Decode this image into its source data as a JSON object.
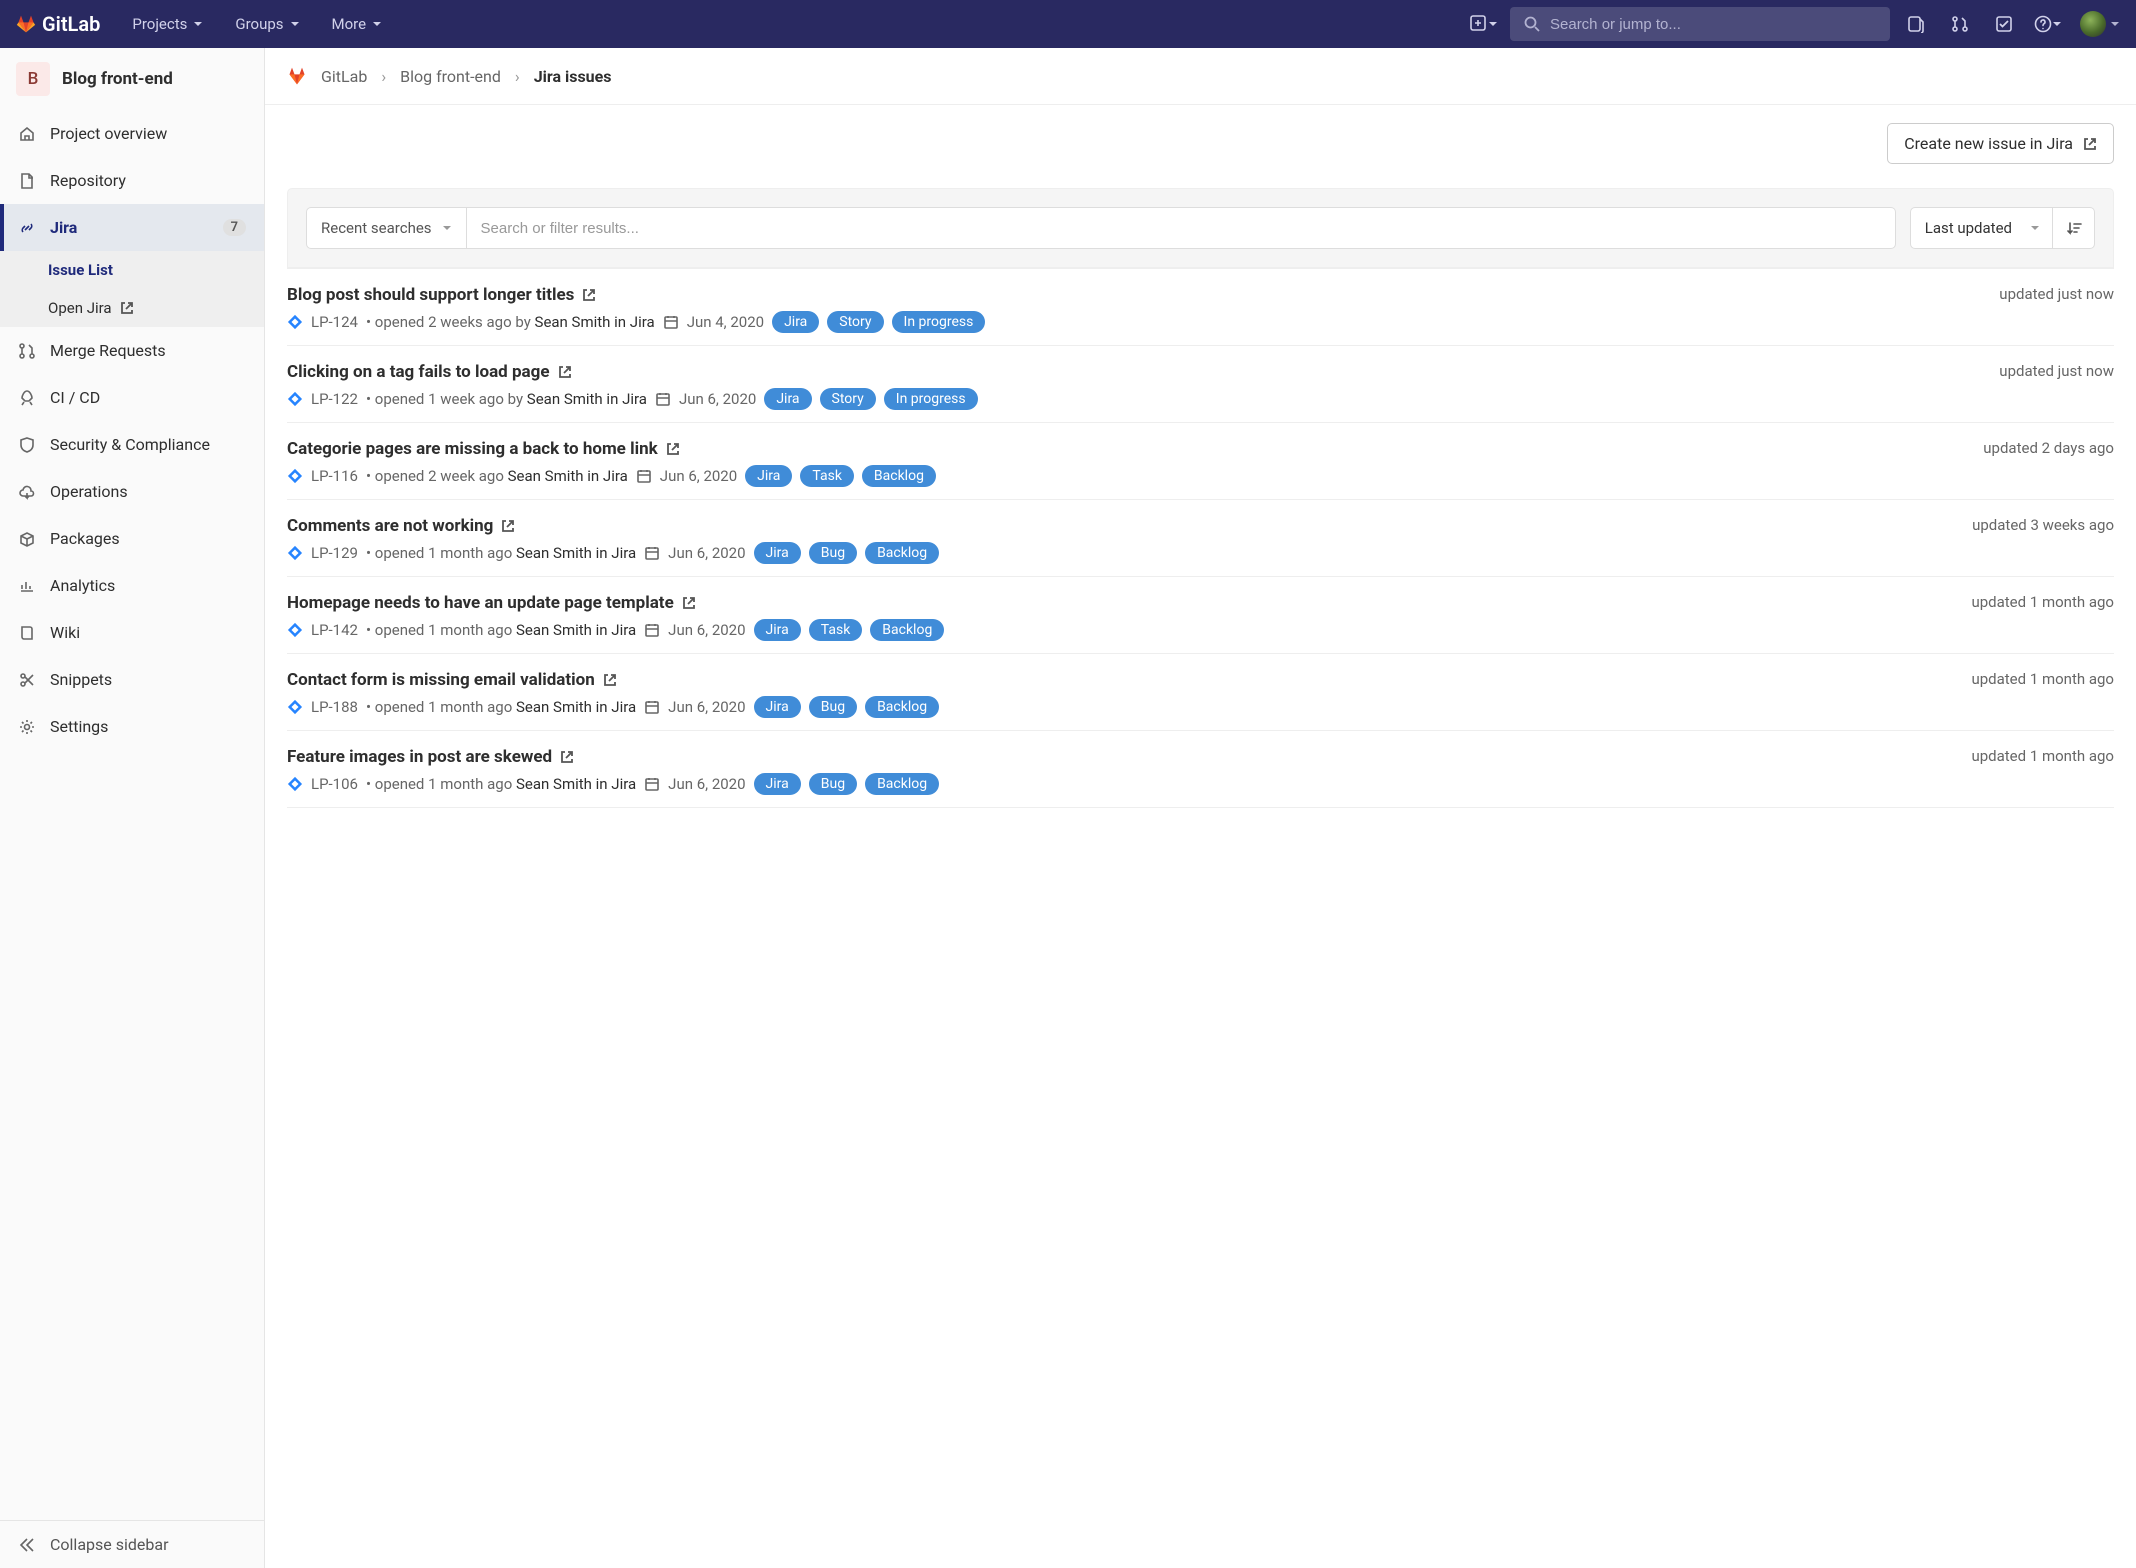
{
  "topnav": {
    "brand": "GitLab",
    "menu": [
      "Projects",
      "Groups",
      "More"
    ],
    "search_placeholder": "Search or jump to..."
  },
  "sidebar": {
    "project_initial": "B",
    "project_name": "Blog front-end",
    "items": [
      {
        "label": "Project overview",
        "icon": "home"
      },
      {
        "label": "Repository",
        "icon": "file"
      },
      {
        "label": "Jira",
        "icon": "link",
        "badge": "7",
        "active": true,
        "sub": [
          {
            "label": "Issue List",
            "active": true
          },
          {
            "label": "Open Jira",
            "ext": true
          }
        ]
      },
      {
        "label": "Merge Requests",
        "icon": "merge"
      },
      {
        "label": "CI / CD",
        "icon": "rocket"
      },
      {
        "label": "Security & Compliance",
        "icon": "shield"
      },
      {
        "label": "Operations",
        "icon": "cloud"
      },
      {
        "label": "Packages",
        "icon": "package"
      },
      {
        "label": "Analytics",
        "icon": "chart"
      },
      {
        "label": "Wiki",
        "icon": "book"
      },
      {
        "label": "Snippets",
        "icon": "scissors"
      },
      {
        "label": "Settings",
        "icon": "gear"
      }
    ],
    "collapse_label": "Collapse sidebar"
  },
  "breadcrumb": {
    "root": "GitLab",
    "project": "Blog front-end",
    "page": "Jira issues"
  },
  "actions": {
    "create_issue": "Create new issue in Jira"
  },
  "filter": {
    "recent_label": "Recent searches",
    "filter_placeholder": "Search or filter results...",
    "sort_label": "Last updated"
  },
  "issues": [
    {
      "title": "Blog post should support longer titles",
      "key": "LP-124",
      "opened": "opened 2 weeks ago by",
      "author": "Sean Smith in Jira",
      "date": "Jun 4, 2020",
      "tags": [
        "Jira",
        "Story",
        "In progress"
      ],
      "updated": "updated just now"
    },
    {
      "title": "Clicking on a tag fails to load page",
      "key": "LP-122",
      "opened": "opened 1 week ago by",
      "author": "Sean Smith in Jira",
      "date": "Jun 6, 2020",
      "tags": [
        "Jira",
        "Story",
        "In progress"
      ],
      "updated": "updated just now"
    },
    {
      "title": "Categorie pages are missing a back to home link",
      "key": "LP-116",
      "opened": "opened 2 week ago",
      "author": "Sean Smith in Jira",
      "date": "Jun 6, 2020",
      "tags": [
        "Jira",
        "Task",
        "Backlog"
      ],
      "updated": "updated 2 days ago"
    },
    {
      "title": "Comments are not working",
      "key": "LP-129",
      "opened": "opened 1 month ago",
      "author": "Sean Smith in Jira",
      "date": "Jun 6, 2020",
      "tags": [
        "Jira",
        "Bug",
        "Backlog"
      ],
      "updated": "updated 3 weeks ago"
    },
    {
      "title": "Homepage needs to have an update page template",
      "key": "LP-142",
      "opened": "opened 1 month ago",
      "author": "Sean Smith in Jira",
      "date": "Jun 6, 2020",
      "tags": [
        "Jira",
        "Task",
        "Backlog"
      ],
      "updated": "updated 1 month ago"
    },
    {
      "title": "Contact form is missing email validation",
      "key": "LP-188",
      "opened": "opened 1 month ago",
      "author": "Sean Smith in Jira",
      "date": "Jun 6, 2020",
      "tags": [
        "Jira",
        "Bug",
        "Backlog"
      ],
      "updated": "updated 1 month ago"
    },
    {
      "title": "Feature images in post are skewed",
      "key": "LP-106",
      "opened": "opened 1 month ago",
      "author": "Sean Smith in Jira",
      "date": "Jun 6, 2020",
      "tags": [
        "Jira",
        "Bug",
        "Backlog"
      ],
      "updated": "updated 1 month ago"
    }
  ]
}
